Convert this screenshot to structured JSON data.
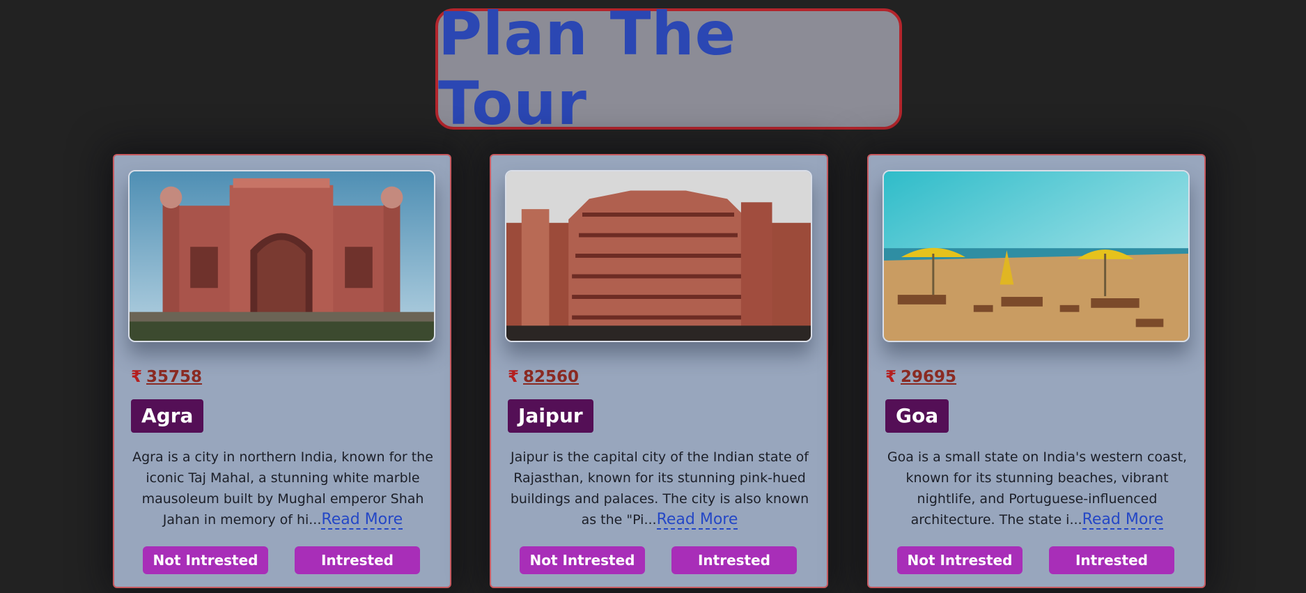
{
  "header": {
    "title": "Plan The Tour"
  },
  "currency_symbol": "₹",
  "read_more_label": "Read More",
  "buttons": {
    "not_interested": "Not Intrested",
    "interested": "Intrested"
  },
  "cards": [
    {
      "price": "35758",
      "city": "Agra",
      "description": "Agra is a city in northern India, known for the iconic Taj Mahal, a stunning white marble mausoleum built by Mughal emperor Shah Jahan in memory of hi...",
      "image": "gate-monument-photo"
    },
    {
      "price": "82560",
      "city": "Jaipur",
      "description": "Jaipur is the capital city of the Indian state of Rajasthan, known for its stunning pink-hued buildings and palaces. The city is also known as the \"Pi...",
      "image": "palace-facade-photo"
    },
    {
      "price": "29695",
      "city": "Goa",
      "description": "Goa is a small state on India's western coast, known for its stunning beaches, vibrant nightlife, and Portuguese-influenced architecture. The state i...",
      "image": "beach-umbrellas-photo"
    }
  ],
  "colors": {
    "page_bg": "#222222",
    "card_bg": "#98a6bd",
    "title_text": "#2b47b3",
    "title_border": "#b3252c",
    "city_badge": "#540f56",
    "button": "#a82eb8",
    "link": "#2447c6"
  }
}
